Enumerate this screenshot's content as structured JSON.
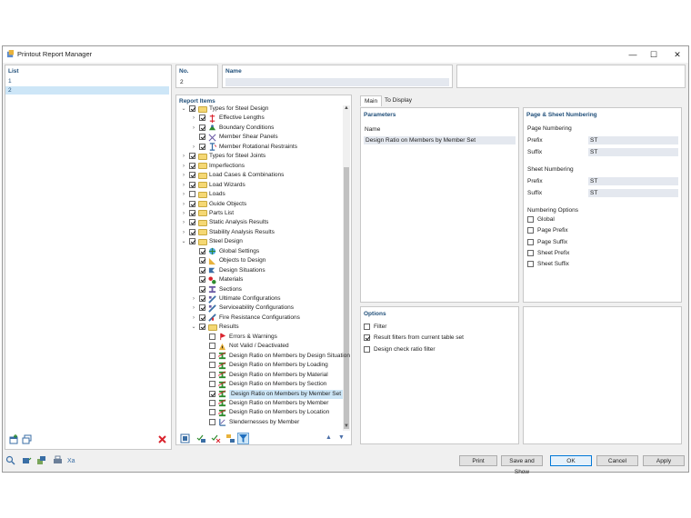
{
  "window": {
    "title": "Printout Report Manager",
    "minimize_label": "—",
    "maximize_label": "☐",
    "close_label": "✕"
  },
  "list": {
    "header": "List",
    "items": [
      "1",
      "2"
    ],
    "selected_index": 1
  },
  "no": {
    "header": "No.",
    "value": "2"
  },
  "name_field": {
    "header": "Name",
    "value": ""
  },
  "report_items": {
    "header": "Report Items"
  },
  "tree": [
    {
      "label": "Types for Steel Design",
      "level": 0,
      "expander": "open",
      "checked": true,
      "icon": "folder-icon"
    },
    {
      "label": "Effective Lengths",
      "level": 1,
      "expander": "closed",
      "checked": true,
      "icon": "effective-lengths-icon"
    },
    {
      "label": "Boundary Conditions",
      "level": 1,
      "expander": "closed",
      "checked": true,
      "icon": "boundary-conditions-icon"
    },
    {
      "label": "Member Shear Panels",
      "level": 1,
      "expander": "",
      "checked": true,
      "icon": "shear-panel-icon"
    },
    {
      "label": "Member Rotational Restraints",
      "level": 1,
      "expander": "closed",
      "checked": true,
      "icon": "rotational-restraint-icon"
    },
    {
      "label": "Types for Steel Joints",
      "level": 0,
      "expander": "closed",
      "checked": true,
      "icon": "folder-icon"
    },
    {
      "label": "Imperfections",
      "level": 0,
      "expander": "closed",
      "checked": true,
      "icon": "folder-icon"
    },
    {
      "label": "Load Cases & Combinations",
      "level": 0,
      "expander": "closed",
      "checked": true,
      "icon": "folder-icon"
    },
    {
      "label": "Load Wizards",
      "level": 0,
      "expander": "closed",
      "checked": true,
      "icon": "folder-icon"
    },
    {
      "label": "Loads",
      "level": 0,
      "expander": "closed",
      "checked": false,
      "icon": "folder-icon"
    },
    {
      "label": "Guide Objects",
      "level": 0,
      "expander": "closed",
      "checked": true,
      "icon": "folder-icon"
    },
    {
      "label": "Parts List",
      "level": 0,
      "expander": "closed",
      "checked": true,
      "icon": "folder-icon"
    },
    {
      "label": "Static Analysis Results",
      "level": 0,
      "expander": "closed",
      "checked": true,
      "icon": "folder-icon"
    },
    {
      "label": "Stability Analysis Results",
      "level": 0,
      "expander": "closed",
      "checked": true,
      "icon": "folder-icon"
    },
    {
      "label": "Steel Design",
      "level": 0,
      "expander": "open",
      "checked": true,
      "icon": "folder-icon"
    },
    {
      "label": "Global Settings",
      "level": 1,
      "expander": "",
      "checked": true,
      "icon": "globe-icon"
    },
    {
      "label": "Objects to Design",
      "level": 1,
      "expander": "",
      "checked": true,
      "icon": "objects-icon"
    },
    {
      "label": "Design Situations",
      "level": 1,
      "expander": "",
      "checked": true,
      "icon": "design-situations-icon"
    },
    {
      "label": "Materials",
      "level": 1,
      "expander": "",
      "checked": true,
      "icon": "materials-icon"
    },
    {
      "label": "Sections",
      "level": 1,
      "expander": "",
      "checked": true,
      "icon": "sections-icon"
    },
    {
      "label": "Ultimate Configurations",
      "level": 1,
      "expander": "closed",
      "checked": true,
      "icon": "configuration-icon"
    },
    {
      "label": "Serviceability Configurations",
      "level": 1,
      "expander": "closed",
      "checked": true,
      "icon": "configuration-icon"
    },
    {
      "label": "Fire Resistance Configurations",
      "level": 1,
      "expander": "closed",
      "checked": true,
      "icon": "fire-config-icon"
    },
    {
      "label": "Results",
      "level": 1,
      "expander": "open",
      "checked": true,
      "icon": "folder-icon"
    },
    {
      "label": "Errors & Warnings",
      "level": 2,
      "expander": "",
      "checked": false,
      "icon": "warning-icon"
    },
    {
      "label": "Not Valid / Deactivated",
      "level": 2,
      "expander": "",
      "checked": false,
      "icon": "not-valid-icon"
    },
    {
      "label": "Design Ratio on Members by Design Situation",
      "level": 2,
      "expander": "",
      "checked": false,
      "icon": "design-ratio-icon"
    },
    {
      "label": "Design Ratio on Members by Loading",
      "level": 2,
      "expander": "",
      "checked": false,
      "icon": "design-ratio-icon"
    },
    {
      "label": "Design Ratio on Members by Material",
      "level": 2,
      "expander": "",
      "checked": false,
      "icon": "design-ratio-icon"
    },
    {
      "label": "Design Ratio on Members by Section",
      "level": 2,
      "expander": "",
      "checked": false,
      "icon": "design-ratio-icon"
    },
    {
      "label": "Design Ratio on Members by Member Set",
      "level": 2,
      "expander": "",
      "checked": true,
      "icon": "design-ratio-icon",
      "selected": true
    },
    {
      "label": "Design Ratio on Members by Member",
      "level": 2,
      "expander": "",
      "checked": false,
      "icon": "design-ratio-icon"
    },
    {
      "label": "Design Ratio on Members by Location",
      "level": 2,
      "expander": "",
      "checked": false,
      "icon": "design-ratio-icon"
    },
    {
      "label": "Slendernesses by Member",
      "level": 2,
      "expander": "",
      "checked": false,
      "icon": "slenderness-icon"
    }
  ],
  "tabs": {
    "main": "Main",
    "to_display": "To Display"
  },
  "parameters": {
    "header": "Parameters",
    "name_label": "Name",
    "name_value": "Design Ratio on Members by Member Set"
  },
  "numbering": {
    "header": "Page & Sheet Numbering",
    "page_numbering": "Page Numbering",
    "page_prefix_label": "Prefix",
    "page_prefix_value": "ST",
    "page_suffix_label": "Suffix",
    "page_suffix_value": "ST",
    "sheet_numbering": "Sheet Numbering",
    "sheet_prefix_label": "Prefix",
    "sheet_prefix_value": "ST",
    "sheet_suffix_label": "Suffix",
    "sheet_suffix_value": "ST",
    "options_header": "Numbering Options",
    "options": [
      {
        "label": "Global",
        "checked": false
      },
      {
        "label": "Page Prefix",
        "checked": false
      },
      {
        "label": "Page Suffix",
        "checked": false
      },
      {
        "label": "Sheet Prefix",
        "checked": false
      },
      {
        "label": "Sheet Suffix",
        "checked": false
      }
    ]
  },
  "options": {
    "header": "Options",
    "items": [
      {
        "label": "Filter",
        "checked": false
      },
      {
        "label": "Result filters from current table set",
        "checked": true
      },
      {
        "label": "Design check ratio filter",
        "checked": false
      }
    ]
  },
  "buttons": {
    "print": "Print",
    "save_and_show": "Save and Show",
    "ok": "OK",
    "cancel": "Cancel",
    "apply": "Apply"
  },
  "colors": {
    "header_blue": "#1f4e79",
    "selection": "#cde6f7",
    "folder": "#f5d874",
    "delete_red": "#d9232d",
    "ok_border": "#0078d7"
  }
}
